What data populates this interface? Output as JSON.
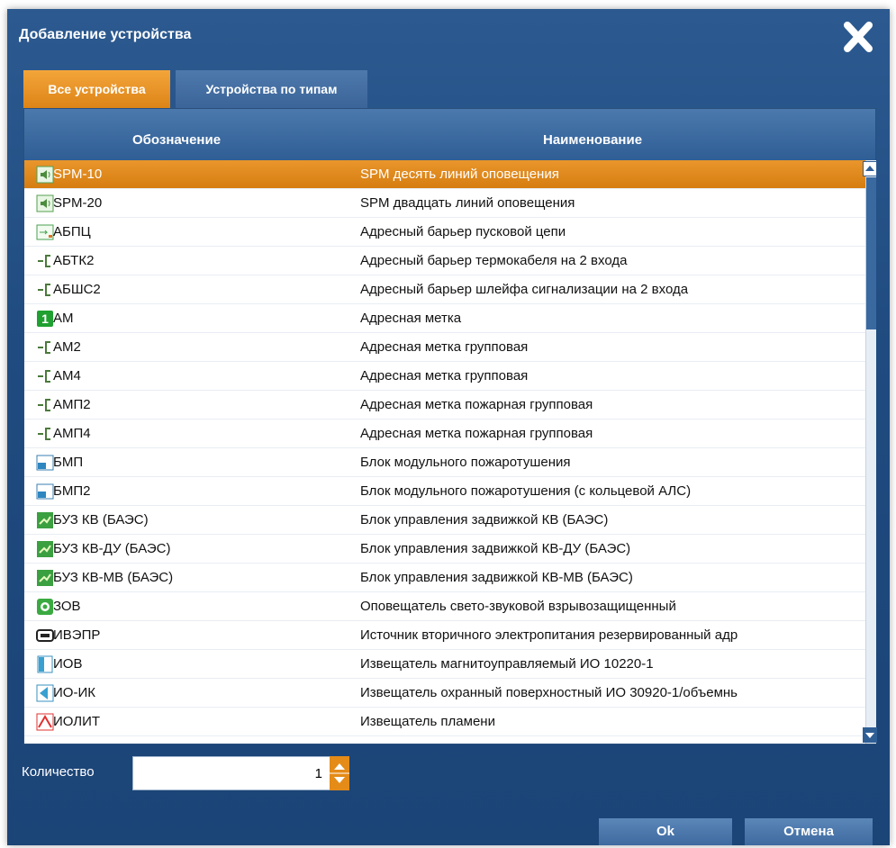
{
  "window": {
    "title": "Добавление устройства"
  },
  "tabs": [
    {
      "label": "Все устройства",
      "active": true
    },
    {
      "label": "Устройства по типам",
      "active": false
    }
  ],
  "table": {
    "headers": [
      "Обозначение",
      "Наименование"
    ],
    "selected_index": 0,
    "rows": [
      {
        "code": "SPM-10",
        "name": "SPM десять линий оповещения",
        "icon": "speaker-icon"
      },
      {
        "code": "SPM-20",
        "name": "SPM двадцать линий оповещения",
        "icon": "speaker-icon"
      },
      {
        "code": "АБПЦ",
        "name": "Адресный барьер пусковой цепи",
        "icon": "barrier-icon"
      },
      {
        "code": "АБТК2",
        "name": "Адресный барьер термокабеля на 2 входа",
        "icon": "connector-icon"
      },
      {
        "code": "АБШС2",
        "name": "Адресный барьер шлейфа сигнализации на 2 входа",
        "icon": "connector-icon"
      },
      {
        "code": "АМ",
        "name": "Адресная метка",
        "icon": "number-one-icon"
      },
      {
        "code": "АМ2",
        "name": "Адресная метка групповая",
        "icon": "connector-icon"
      },
      {
        "code": "АМ4",
        "name": "Адресная метка групповая",
        "icon": "connector-icon"
      },
      {
        "code": "АМП2",
        "name": "Адресная метка пожарная групповая",
        "icon": "connector-icon"
      },
      {
        "code": "АМП4",
        "name": "Адресная метка пожарная групповая",
        "icon": "connector-icon"
      },
      {
        "code": "БМП",
        "name": "Блок модульного пожаротушения",
        "icon": "module-icon"
      },
      {
        "code": "БМП2",
        "name": "Блок модульного пожаротушения (с кольцевой АЛС)",
        "icon": "module-icon"
      },
      {
        "code": "БУЗ КВ (БАЭС)",
        "name": "Блок управления задвижкой КВ (БАЭС)",
        "icon": "valve-icon"
      },
      {
        "code": "БУЗ КВ-ДУ (БАЭС)",
        "name": "Блок управления задвижкой КВ-ДУ (БАЭС)",
        "icon": "valve-icon"
      },
      {
        "code": "БУЗ КВ-МВ (БАЭС)",
        "name": "Блок управления задвижкой КВ-МВ (БАЭС)",
        "icon": "valve-icon"
      },
      {
        "code": "ЗОВ",
        "name": "Оповещатель свето-звуковой взрывозащищенный",
        "icon": "siren-icon"
      },
      {
        "code": "ИВЭПР",
        "name": "Источник вторичного электропитания резервированный адр",
        "icon": "power-supply-icon"
      },
      {
        "code": "ИОВ",
        "name": "Извещатель магнитоуправляемый ИО 10220-1",
        "icon": "magnetic-detector-icon"
      },
      {
        "code": "ИО-ИК",
        "name": "Извещатель охранный поверхностный ИО 30920-1/объемнь",
        "icon": "ir-detector-icon"
      },
      {
        "code": "ИОЛИТ",
        "name": "Извещатель пламени",
        "icon": "flame-detector-icon"
      }
    ]
  },
  "quantity": {
    "label": "Количество",
    "value": "1"
  },
  "buttons": {
    "ok": "Ok",
    "cancel": "Отмена"
  },
  "colors": {
    "accent": "#dd8417",
    "dialog_bg": "#1f4b80",
    "header_bg": "#2f5e95"
  }
}
